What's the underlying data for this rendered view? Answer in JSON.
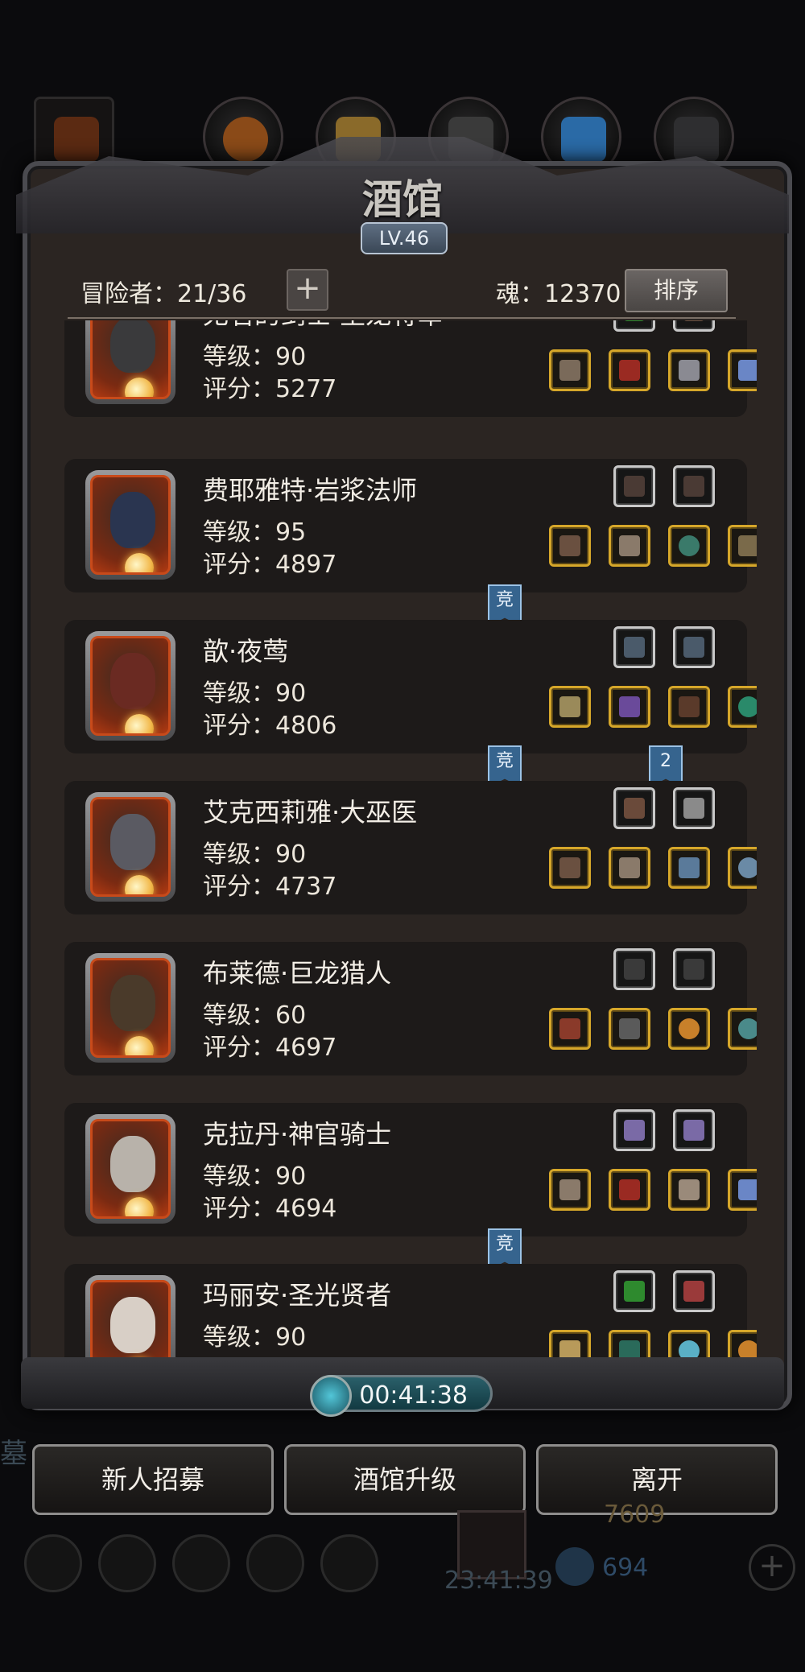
{
  "header": {
    "title": "酒馆",
    "level": "LV.46",
    "adventurers_label": "冒险者：21/36",
    "soul_label": "魂：12370",
    "sort_button": "排序",
    "plus_button": "+"
  },
  "heroes": [
    {
      "name": "无名的剑士·圣龙将军",
      "level": "等级：90",
      "score": "评分：5277"
    },
    {
      "name": "费耶雅特·岩浆法师",
      "level": "等级：95",
      "score": "评分：4897"
    },
    {
      "name": "歆·夜莺",
      "level": "等级：90",
      "score": "评分：4806"
    },
    {
      "name": "艾克西莉雅·大巫医",
      "level": "等级：90",
      "score": "评分：4737"
    },
    {
      "name": "布莱德·巨龙猎人",
      "level": "等级：60",
      "score": "评分：4697"
    },
    {
      "name": "克拉丹·神官骑士",
      "level": "等级：90",
      "score": "评分：4694"
    },
    {
      "name": "玛丽安·圣光贤者",
      "level": "等级：90",
      "score": ""
    }
  ],
  "badges": {
    "compete": "竞",
    "two": "2"
  },
  "timer": "00:41:38",
  "buttons": {
    "recruit": "新人招募",
    "upgrade": "酒馆升级",
    "leave": "离开"
  },
  "background": {
    "gold": "7609",
    "gems": "694",
    "clock": "23:41:39",
    "side_text": "墓"
  },
  "colors": {
    "gold_frame": "#d6a72a",
    "silver_frame": "#c9c9c9",
    "panel": "#2b2522"
  }
}
